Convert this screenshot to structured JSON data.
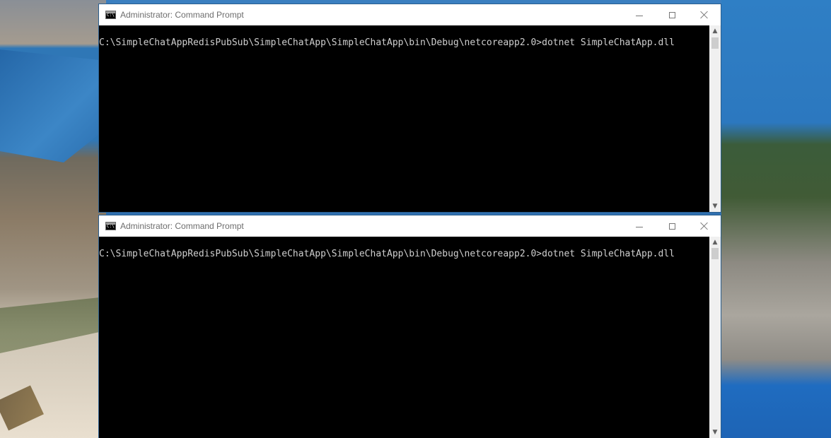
{
  "windows": [
    {
      "title": "Administrator: Command Prompt",
      "console_text": "C:\\SimpleChatAppRedisPubSub\\SimpleChatApp\\SimpleChatApp\\bin\\Debug\\netcoreapp2.0>dotnet SimpleChatApp.dll",
      "icon": "cmd-icon"
    },
    {
      "title": "Administrator: Command Prompt",
      "console_text": "C:\\SimpleChatAppRedisPubSub\\SimpleChatApp\\SimpleChatApp\\bin\\Debug\\netcoreapp2.0>dotnet SimpleChatApp.dll",
      "icon": "cmd-icon"
    }
  ],
  "controls": {
    "minimize_icon": "minimize-icon",
    "maximize_icon": "maximize-icon",
    "close_icon": "close-icon"
  },
  "colors": {
    "console_bg": "#000000",
    "console_text": "#cfcfcf",
    "titlebar_bg": "#ffffff",
    "title_text": "#6d6d6d"
  }
}
